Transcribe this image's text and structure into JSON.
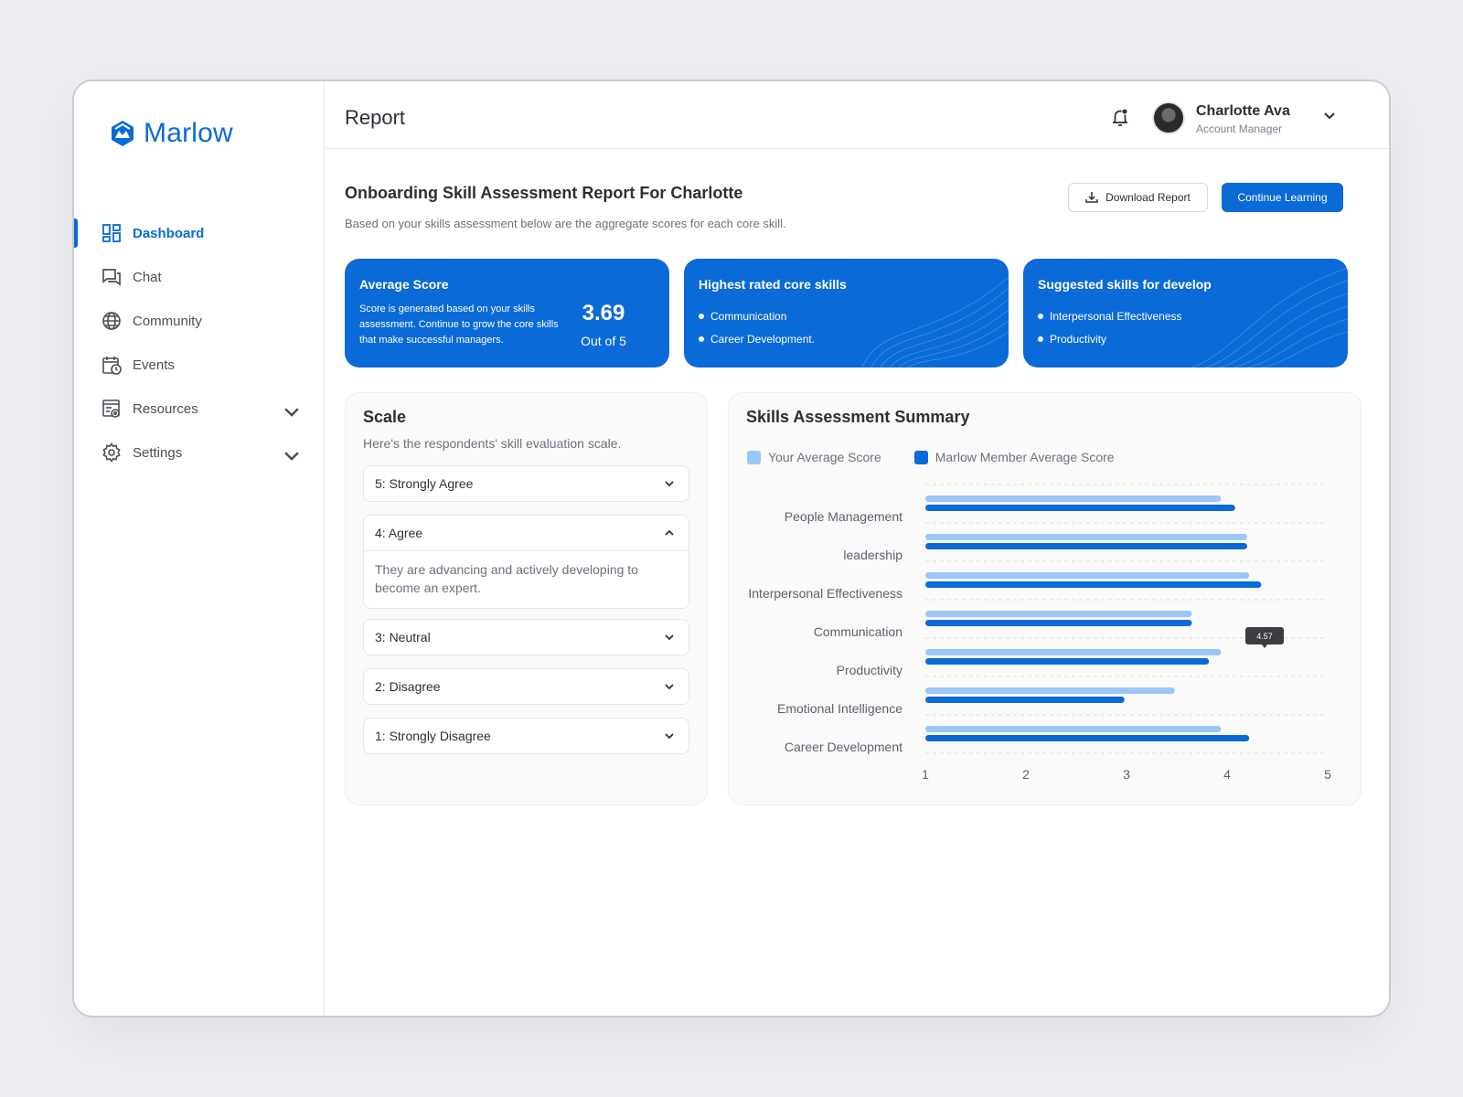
{
  "brand": {
    "name": "Marlow",
    "color": "#0a6ad8"
  },
  "sidebar": {
    "items": [
      {
        "label": "Dashboard",
        "icon": "dashboard-icon",
        "active": true
      },
      {
        "label": "Chat",
        "icon": "chat-icon"
      },
      {
        "label": "Community",
        "icon": "globe-icon"
      },
      {
        "label": "Events",
        "icon": "calendar-icon"
      },
      {
        "label": "Resources",
        "icon": "resources-icon",
        "expandable": true
      },
      {
        "label": "Settings",
        "icon": "gear-icon",
        "expandable": true
      }
    ]
  },
  "header": {
    "title": "Report",
    "user": {
      "name": "Charlotte Ava",
      "role": "Account Manager"
    }
  },
  "report": {
    "title": "Onboarding Skill Assessment Report For Charlotte",
    "subtitle": "Based on your skills assessment below are the aggregate scores for each core skill.",
    "download_label": "Download Report",
    "continue_label": "Continue Learning"
  },
  "cards": {
    "average": {
      "title": "Average Score",
      "description": "Score is generated based on your skills assessment. Continue to grow the core skills that make successful managers.",
      "score": "3.69",
      "out_of": "Out of 5"
    },
    "highest": {
      "title": "Highest rated core skills",
      "items": [
        "Communication",
        "Career Development."
      ]
    },
    "suggested": {
      "title": "Suggested skills for develop",
      "items": [
        "Interpersonal Effectiveness",
        "Productivity"
      ]
    }
  },
  "scale": {
    "title": "Scale",
    "subtitle": "Here's the respondents' skill evaluation scale.",
    "items": [
      {
        "label": "5: Strongly Agree",
        "expanded": false
      },
      {
        "label": "4: Agree",
        "expanded": true,
        "body": "They are advancing and actively developing to become an expert."
      },
      {
        "label": "3: Neutral",
        "expanded": false
      },
      {
        "label": "2: Disagree",
        "expanded": false
      },
      {
        "label": "1: Strongly Disagree",
        "expanded": false
      }
    ]
  },
  "summary": {
    "title": "Skills Assessment Summary",
    "tooltip": "4.57"
  },
  "chart_data": {
    "type": "bar",
    "orientation": "horizontal",
    "categories": [
      "People Management",
      "leadership",
      "Interpersonal Effectiveness",
      "Communication",
      "Productivity",
      "Emotional Intelligence",
      "Career Development"
    ],
    "series": [
      {
        "name": "Your Average Score",
        "color": "#9cc5f8",
        "values": [
          3.94,
          4.2,
          4.22,
          3.65,
          3.94,
          3.48,
          3.94
        ]
      },
      {
        "name": "Marlow Member Average Score",
        "color": "#0a6ad8",
        "values": [
          4.08,
          4.2,
          4.34,
          3.65,
          3.82,
          2.98,
          4.22
        ]
      }
    ],
    "xlim": [
      1,
      5
    ],
    "xticks": [
      "1",
      "2",
      "3",
      "4",
      "5"
    ],
    "grid": true,
    "legend": "top-left"
  }
}
